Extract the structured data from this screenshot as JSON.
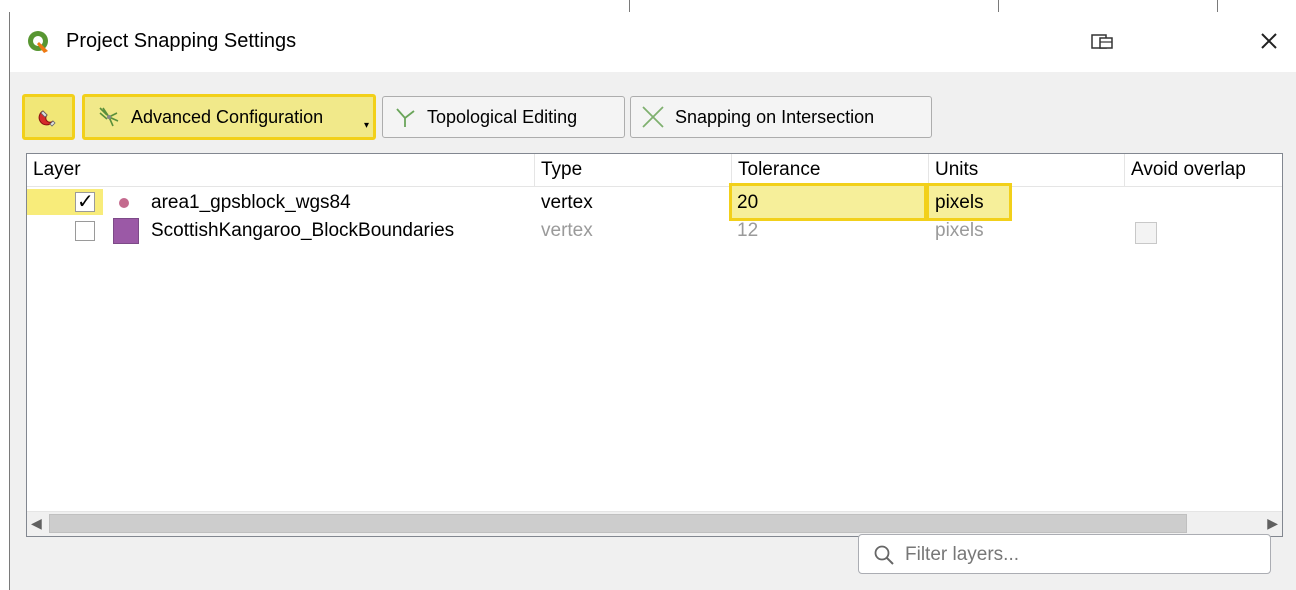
{
  "window": {
    "title": "Project Snapping Settings",
    "icons": {
      "app": "qgis-logo-icon",
      "restore": "restore-window-icon",
      "close": "close-icon"
    },
    "close_glyph": "✕"
  },
  "toolbar": {
    "enable_snapping": {
      "icon": "magnet-icon",
      "active": true
    },
    "advanced_configuration": {
      "label": "Advanced Configuration",
      "icon": "advanced-config-icon",
      "has_dropdown": true
    },
    "topological_editing": {
      "label": "Topological Editing",
      "icon": "topological-editing-icon"
    },
    "snapping_on_intersection": {
      "label": "Snapping on Intersection",
      "icon": "intersection-icon"
    }
  },
  "table": {
    "columns": [
      "Layer",
      "Type",
      "Tolerance",
      "Units",
      "Avoid overlap"
    ],
    "rows": [
      {
        "checked": true,
        "layer": "area1_gpsblock_wgs84",
        "layer_icon": "point-layer-icon",
        "type": "vertex",
        "tolerance": "20",
        "units": "pixels",
        "avoid_overlap": null,
        "enabled": true
      },
      {
        "checked": false,
        "layer": "ScottishKangaroo_BlockBoundaries",
        "layer_icon": "polygon-layer-icon",
        "type": "vertex",
        "tolerance": "12",
        "units": "pixels",
        "avoid_overlap": false,
        "enabled": false
      }
    ]
  },
  "filter": {
    "placeholder": "Filter layers...",
    "value": ""
  },
  "colors": {
    "highlight": "#f2d01a",
    "polygon_fill": "#9b59a6",
    "point_fill": "#c46a8e",
    "dialog_bg": "#f0f0f0"
  }
}
